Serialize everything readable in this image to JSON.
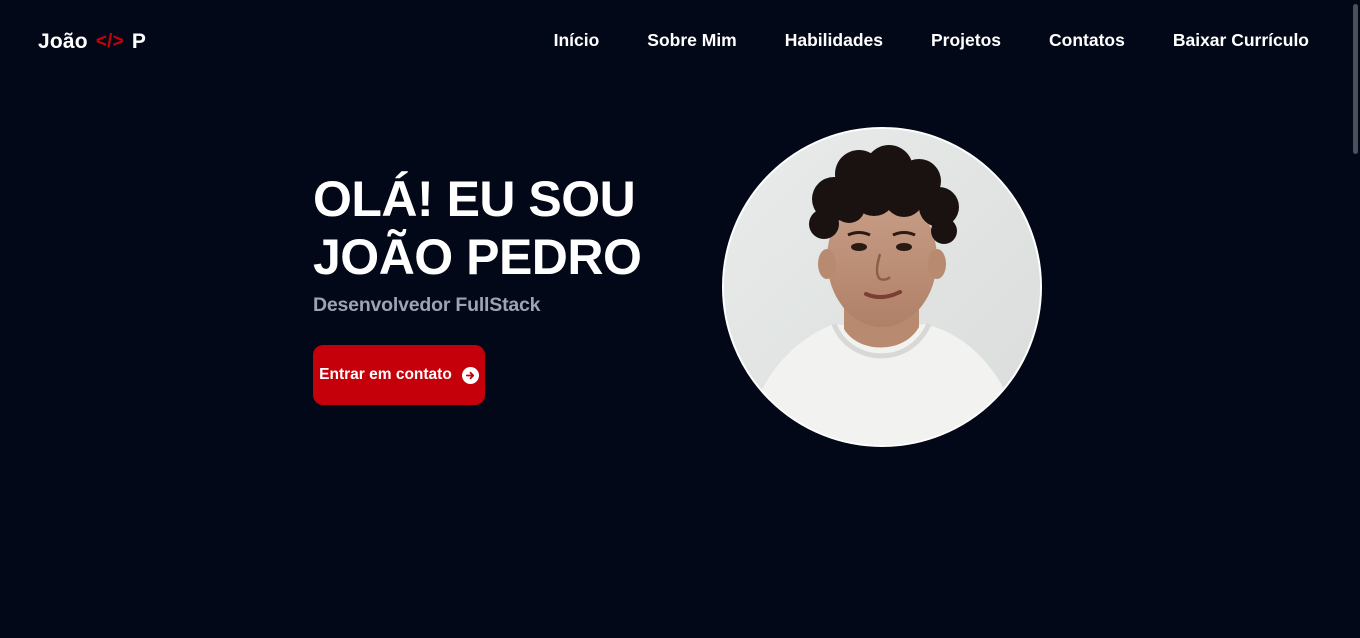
{
  "header": {
    "logo": {
      "first": "João",
      "code": "</>",
      "last": "P"
    },
    "nav": [
      {
        "label": "Início"
      },
      {
        "label": "Sobre Mim"
      },
      {
        "label": "Habilidades"
      },
      {
        "label": "Projetos"
      },
      {
        "label": "Contatos"
      },
      {
        "label": "Baixar Currículo"
      }
    ]
  },
  "hero": {
    "title_line1": "OLÁ! EU SOU",
    "title_line2": "JOÃO PEDRO",
    "subtitle": "Desenvolvedor FullStack",
    "cta_label": "Entrar em contato",
    "cta_icon": "arrow-circle-right-icon",
    "portrait": "profile-photo"
  },
  "colors": {
    "background": "#020817",
    "accent": "#c6000b",
    "subtitle": "#9ba3b4",
    "text": "#ffffff"
  }
}
